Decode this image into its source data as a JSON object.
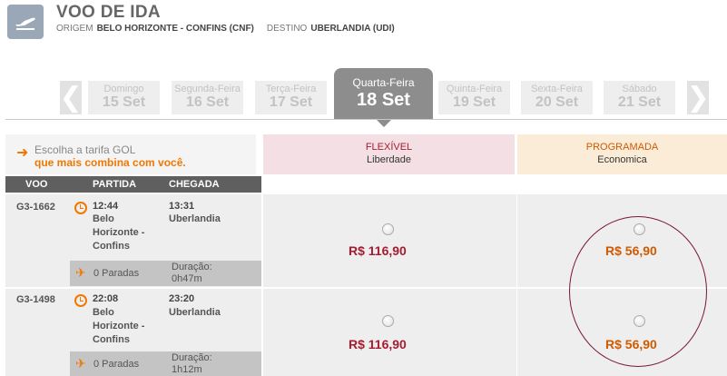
{
  "header": {
    "title": "VOO DE IDA",
    "origin_label": "ORIGEM",
    "origin_value": "BELO HORIZONTE - CONFINS (CNF)",
    "destination_label": "DESTINO",
    "destination_value": "UBERLANDIA (UDI)",
    "icon": "plane-takeoff-icon"
  },
  "dates": {
    "prev_arrow": "❮",
    "next_arrow": "❯",
    "days": [
      {
        "name": "Domingo",
        "date": "15 Set"
      },
      {
        "name": "Segunda-Feira",
        "date": "16 Set"
      },
      {
        "name": "Terça-Feira",
        "date": "17 Set"
      },
      {
        "name": "Quarta-Feira",
        "date": "18 Set",
        "selected": true
      },
      {
        "name": "Quinta-Feira",
        "date": "19 Set"
      },
      {
        "name": "Sexta-Feira",
        "date": "20 Set"
      },
      {
        "name": "Sábado",
        "date": "21 Set"
      }
    ]
  },
  "promo": {
    "arrow": "➜",
    "line1": "Escolha a tarifa GOL",
    "line2": "que mais combina com você."
  },
  "fares": {
    "flex": {
      "name": "FLEXÍVEL",
      "sub": "Liberdade",
      "color": "#a51c30"
    },
    "prog": {
      "name": "PROGRAMADA",
      "sub": "Economica",
      "color": "#d05a00"
    }
  },
  "columns": {
    "flight": "VOO",
    "departure": "PARTIDA",
    "arrival": "CHEGADA"
  },
  "flights": [
    {
      "number": "G3-1662",
      "dep_time": "12:44",
      "dep_city_1": "Belo",
      "dep_city_2": "Horizonte -",
      "dep_city_3": "Confins",
      "arr_time": "13:31",
      "arr_city": "Uberlandia",
      "stops": "0 Paradas",
      "duration_label": "Duração:",
      "duration": "0h47m",
      "price_flex": "R$ 116,90",
      "price_prog": "R$ 56,90"
    },
    {
      "number": "G3-1498",
      "dep_time": "22:08",
      "dep_city_1": "Belo",
      "dep_city_2": "Horizonte -",
      "dep_city_3": "Confins",
      "arr_time": "23:20",
      "arr_city": "Uberlandia",
      "stops": "0 Paradas",
      "duration_label": "Duração:",
      "duration": "1h12m",
      "price_flex": "R$ 116,90",
      "price_prog": "R$ 56,90"
    }
  ],
  "accent": "#f07800"
}
